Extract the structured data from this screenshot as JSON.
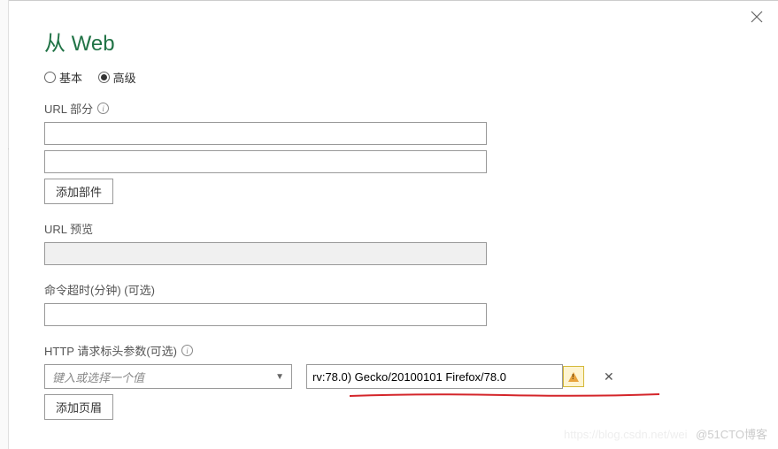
{
  "dialog": {
    "title": "从 Web",
    "mode": {
      "basic_label": "基本",
      "advanced_label": "高级",
      "selected": "advanced"
    },
    "url_parts": {
      "label": "URL 部分",
      "values": [
        "",
        ""
      ],
      "add_button": "添加部件"
    },
    "url_preview": {
      "label": "URL 预览",
      "value": ""
    },
    "timeout": {
      "label": "命令超时(分钟) (可选)",
      "value": ""
    },
    "http_headers": {
      "label": "HTTP 请求标头参数(可选)",
      "name_placeholder": "键入或选择一个值",
      "name_value": "",
      "value": "rv:78.0) Gecko/20100101 Firefox/78.0",
      "add_button": "添加页眉"
    }
  },
  "watermark": {
    "faint": "https://blog.csdn.net/wei",
    "text": "@51CTO博客"
  }
}
